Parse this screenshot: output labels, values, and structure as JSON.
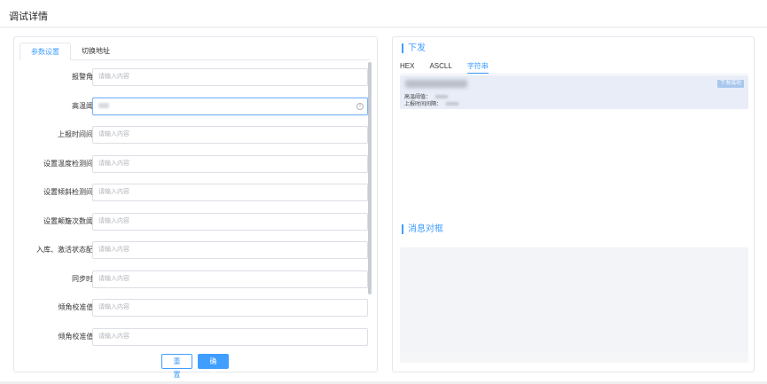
{
  "page": {
    "title": "调试详情"
  },
  "left": {
    "tabs": [
      {
        "label": "参数设置",
        "active": true
      },
      {
        "label": "切换地址",
        "active": false
      }
    ],
    "fields": [
      {
        "label": "报警角度",
        "placeholder": "请输入内容"
      },
      {
        "label": "高温阈值",
        "placeholder": ""
      },
      {
        "label": "上报时间间隔",
        "placeholder": "请输入内容"
      },
      {
        "label": "设置温度检测间隔",
        "placeholder": "请输入内容"
      },
      {
        "label": "设置倾斜检测间隔",
        "placeholder": "请输入内容"
      },
      {
        "label": "设置颠簸次数阈值",
        "placeholder": "请输入内容"
      },
      {
        "label": "入库、激活状态配置",
        "placeholder": "请输入内容"
      },
      {
        "label": "同步时间",
        "placeholder": "请输入内容"
      },
      {
        "label": "倾角校准值 K",
        "placeholder": "请输入内容"
      },
      {
        "label": "倾角校准值 B",
        "placeholder": "请输入内容"
      }
    ],
    "reset_label": "重 置",
    "ok_label": "确 定"
  },
  "right": {
    "downlink_title": "下发",
    "sub_tabs": [
      {
        "label": "HEX",
        "active": false
      },
      {
        "label": "ASCLL",
        "active": false
      },
      {
        "label": "字符串",
        "active": true
      }
    ],
    "message": {
      "line1": "高温阈值：",
      "line2": "上报时间间隔：",
      "badge": "下发成功"
    },
    "dialog_title": "消息对框"
  }
}
